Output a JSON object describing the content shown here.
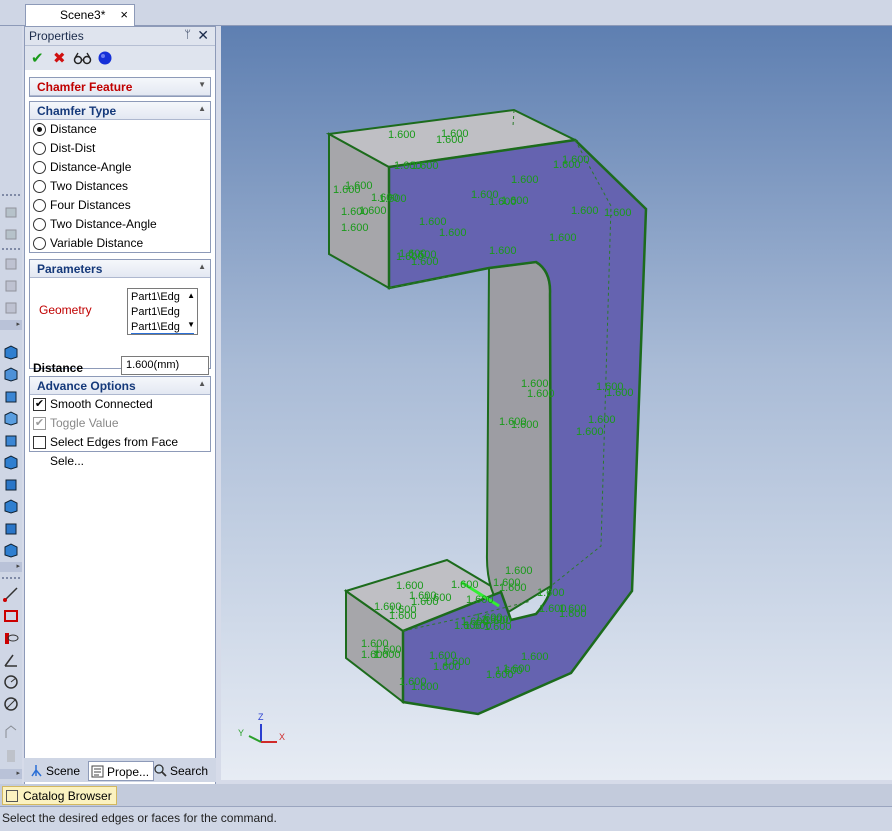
{
  "document_tab": {
    "title": "Scene3*",
    "close_glyph": "×"
  },
  "panel": {
    "title": "Properties",
    "pin_glyph": "ᛘ",
    "close_glyph": "✕",
    "actions": {
      "ok_glyph": "✔",
      "cancel_glyph": "✖"
    }
  },
  "feature": {
    "title": "Chamfer Feature"
  },
  "chamfer_type": {
    "title": "Chamfer Type",
    "options": [
      "Distance",
      "Dist-Dist",
      "Distance-Angle",
      "Two Distances",
      "Four Distances",
      "Two Distance-Angle",
      "Variable Distance"
    ],
    "selected": "Distance"
  },
  "parameters": {
    "title": "Parameters",
    "geometry_label": "Geometry",
    "geometry_items": [
      "Part1\\Edg",
      "Part1\\Edg",
      "Part1\\Edg"
    ],
    "distance_label": "Distance",
    "distance_value": "1.600(mm)"
  },
  "advance_options": {
    "title": "Advance Options",
    "items": [
      {
        "label": "Smooth Connected",
        "checked": true,
        "enabled": true
      },
      {
        "label": "Toggle Value",
        "checked": true,
        "enabled": false
      },
      {
        "label": "Select Edges from Face Sele...",
        "checked": false,
        "enabled": true
      }
    ]
  },
  "bottom_tabs": {
    "scene": "Scene",
    "properties": "Prope...",
    "search": "Search"
  },
  "catalog_browser": "Catalog Browser",
  "status": "Select the desired edges or faces for the command.",
  "viewport": {
    "dimension_label": "1.600",
    "axes": {
      "x": "X",
      "y": "Y",
      "z": "Z"
    },
    "colors": {
      "face": "#6563b0",
      "side": "#a6a6aa",
      "edge": "#1c6b1c",
      "dim": "#1a9a1a"
    }
  }
}
